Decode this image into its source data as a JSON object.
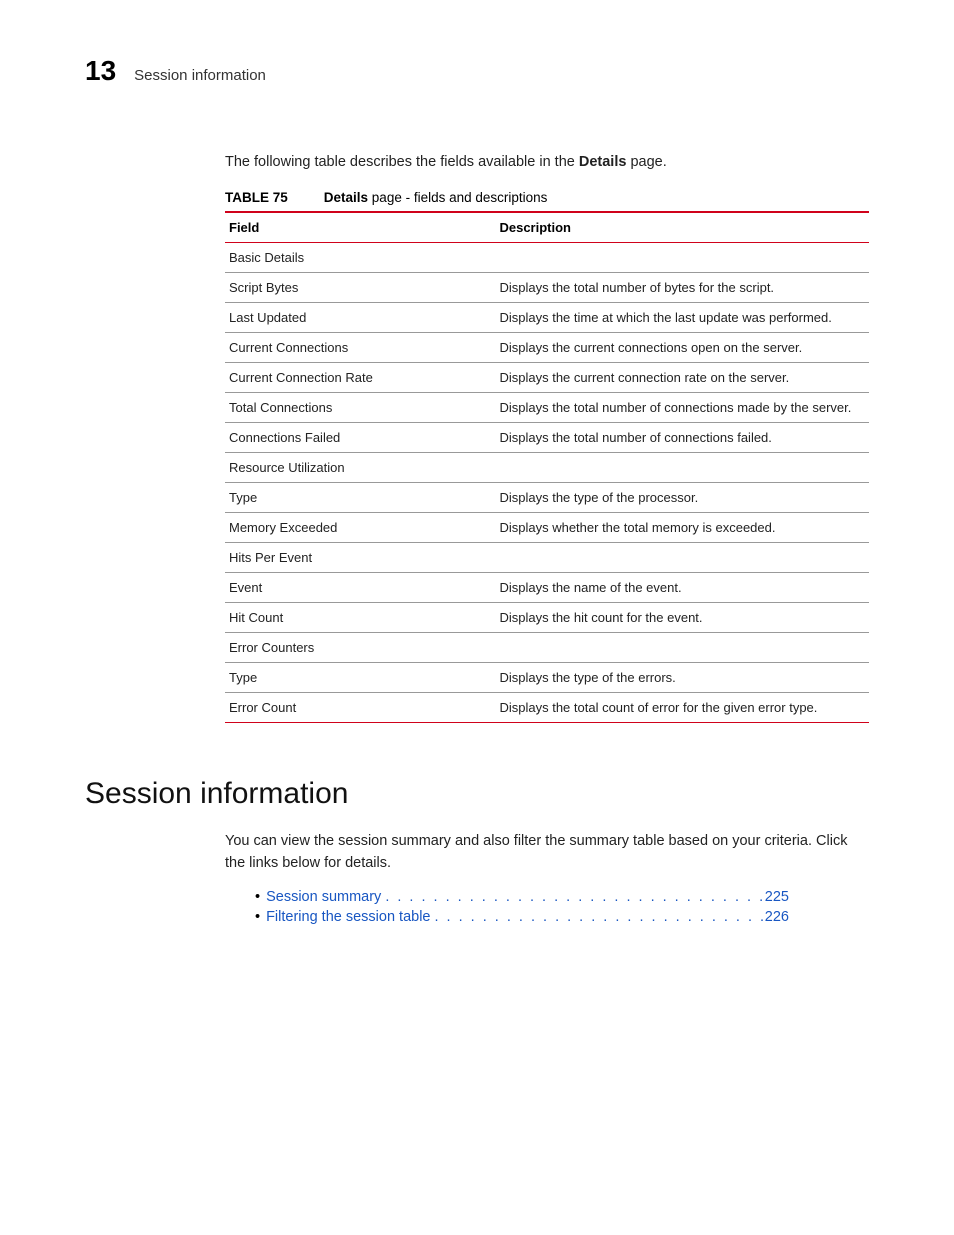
{
  "header": {
    "chapter": "13",
    "title": "Session information"
  },
  "intro": {
    "prefix": "The following table describes the fields available in the ",
    "bold": "Details",
    "suffix": " page."
  },
  "tableCaption": {
    "number": "TABLE 75",
    "titleBold": "Details",
    "titleRest": " page - fields and descriptions"
  },
  "columns": {
    "field": "Field",
    "description": "Description"
  },
  "rows": [
    {
      "field": "Basic Details",
      "description": ""
    },
    {
      "field": "Script Bytes",
      "description": "Displays the total number of bytes for the script."
    },
    {
      "field": "Last Updated",
      "description": "Displays the time at which the last update was performed."
    },
    {
      "field": "Current Connections",
      "description": "Displays the current connections open on the server."
    },
    {
      "field": "Current Connection Rate",
      "description": "Displays the current connection rate on the server."
    },
    {
      "field": "Total Connections",
      "description": "Displays the total number of connections made by the server."
    },
    {
      "field": "Connections Failed",
      "description": "Displays the total number of connections failed."
    },
    {
      "field": "Resource Utilization",
      "description": ""
    },
    {
      "field": "Type",
      "description": "Displays the type of the processor."
    },
    {
      "field": "Memory Exceeded",
      "description": "Displays whether the total memory is exceeded."
    },
    {
      "field": "Hits Per Event",
      "description": ""
    },
    {
      "field": "Event",
      "description": "Displays the name of the event."
    },
    {
      "field": "Hit Count",
      "description": "Displays the hit count for the event."
    },
    {
      "field": "Error Counters",
      "description": ""
    },
    {
      "field": "Type",
      "description": "Displays the type of the errors."
    },
    {
      "field": "Error Count",
      "description": "Displays the total count of error for the given error type."
    }
  ],
  "section": {
    "heading": "Session information",
    "description": "You can view the session summary and also filter the summary table based on your criteria. Click the links below for details."
  },
  "toc": [
    {
      "label": "Session summary",
      "page": "225"
    },
    {
      "label": "Filtering the session table",
      "page": "226"
    }
  ]
}
